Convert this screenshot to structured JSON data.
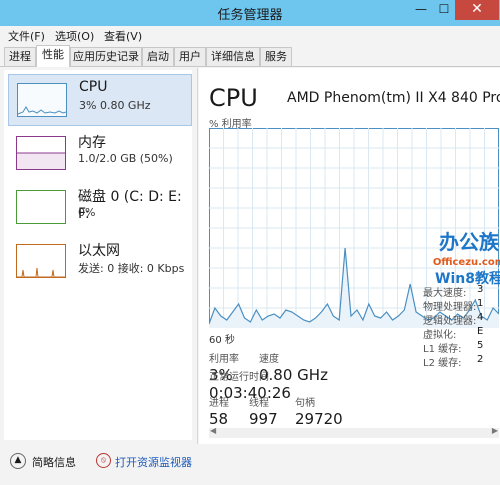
{
  "window": {
    "title": "任务管理器",
    "minimize": "—",
    "maximize": "☐",
    "close": "✕"
  },
  "menu": [
    "文件(F)",
    "选项(O)",
    "查看(V)"
  ],
  "tabs": [
    "进程",
    "性能",
    "应用历史记录",
    "启动",
    "用户",
    "详细信息",
    "服务"
  ],
  "active_tab": "性能",
  "sidebar": [
    {
      "name": "CPU",
      "sub": "3% 0.80 GHz",
      "color": "#4a90c2"
    },
    {
      "name": "内存",
      "sub": "1.0/2.0 GB (50%)",
      "color": "#8b3a8b"
    },
    {
      "name": "磁盘 0 (C: D: E: F:",
      "sub": "0%",
      "color": "#4a9a3a"
    },
    {
      "name": "以太网",
      "sub": "发送: 0 接收: 0 Kbps",
      "color": "#c06a20"
    }
  ],
  "main": {
    "title": "CPU",
    "model": "AMD Phenom(tm) II X4 840 Pro",
    "percent_label": "% 利用率",
    "seconds_label": "60 秒",
    "util_label": "利用率",
    "util_value": "3%",
    "speed_label": "速度",
    "speed_value": "0.80 GHz",
    "proc_label": "进程",
    "proc_value": "58",
    "thread_label": "线程",
    "thread_value": "997",
    "handle_label": "句柄",
    "handle_value": "29720",
    "uptime_label": "正常运行时间",
    "uptime_value": "0:03:40:26",
    "right": [
      {
        "label": "最大速度:",
        "value": "3"
      },
      {
        "label": "物理处理器:",
        "value": "1"
      },
      {
        "label": "逻辑处理器:",
        "value": "4"
      },
      {
        "label": "虚拟化:",
        "value": "E"
      },
      {
        "label": "L1 缓存:",
        "value": "5"
      },
      {
        "label": "L2 缓存:",
        "value": "2"
      }
    ]
  },
  "chart_data": {
    "type": "line",
    "ylabel": "% 利用率",
    "xlabel": "60 秒",
    "ylim": [
      0,
      100
    ],
    "grid": true,
    "series": [
      {
        "values": [
          2,
          10,
          6,
          4,
          8,
          12,
          5,
          3,
          9,
          4,
          6,
          7,
          5,
          9,
          8,
          6,
          4,
          3,
          5,
          8,
          12,
          6,
          4,
          40,
          6,
          9,
          4,
          12,
          6,
          5,
          8,
          4,
          6,
          9,
          22,
          8,
          6,
          4,
          5,
          8,
          6,
          4,
          7,
          5,
          9,
          14,
          6,
          4,
          10,
          7
        ]
      }
    ]
  },
  "watermark": {
    "line1": "办公族",
    "line2": "Officezu.com",
    "line3": "Win8教程"
  },
  "footer": {
    "summary": "简略信息",
    "resmon": "打开资源监视器"
  }
}
